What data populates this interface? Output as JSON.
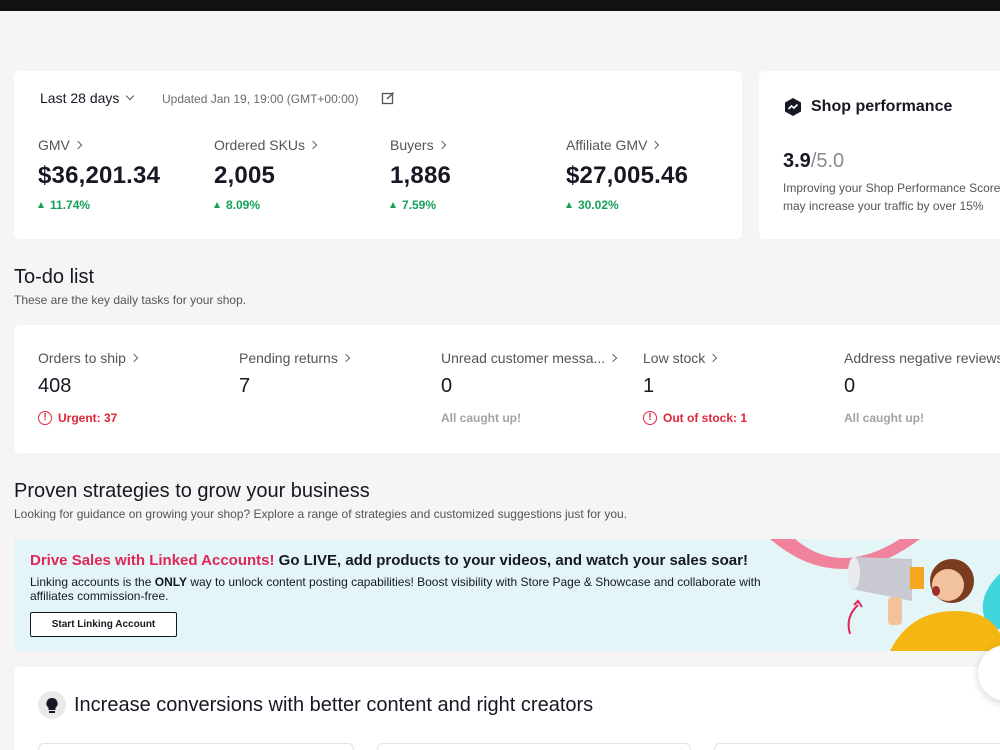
{
  "metrics": {
    "range": "Last 28 days",
    "updated": "Updated Jan 19, 19:00 (GMT+00:00)",
    "items": [
      {
        "label": "GMV",
        "value": "$36,201.34",
        "delta": "11.74%"
      },
      {
        "label": "Ordered SKUs",
        "value": "2,005",
        "delta": "8.09%"
      },
      {
        "label": "Buyers",
        "value": "1,886",
        "delta": "7.59%"
      },
      {
        "label": "Affiliate GMV",
        "value": "$27,005.46",
        "delta": "30.02%"
      }
    ]
  },
  "performance": {
    "title": "Shop performance",
    "score": "3.9",
    "max": "/5.0",
    "description": "Improving your Shop Performance Score may increase your traffic by over 15%"
  },
  "todo": {
    "title": "To-do list",
    "subtitle": "These are the key daily tasks for your shop.",
    "items": [
      {
        "label": "Orders to ship",
        "value": "408",
        "note": "Urgent: 37"
      },
      {
        "label": "Pending returns",
        "value": "7",
        "note": ""
      },
      {
        "label": "Unread customer messa...",
        "value": "0",
        "note": "All caught up!"
      },
      {
        "label": "Low stock",
        "value": "1",
        "note": "Out of stock: 1"
      },
      {
        "label": "Address negative reviews",
        "value": "0",
        "note": "All caught up!"
      }
    ]
  },
  "strategies": {
    "title": "Proven strategies to grow your business",
    "subtitle": "Looking for guidance on growing your shop? Explore a range of strategies and customized suggestions just for you.",
    "banner": {
      "highlight": "Drive Sales with Linked Accounts!",
      "headline": " Go LIVE, add products to your videos, and watch your sales soar!",
      "body_pre": "Linking accounts is the ",
      "body_bold": "ONLY",
      "body_post": " way to unlock content posting capabilities! Boost visibility with Store Page & Showcase and collaborate with affiliates commission-free.",
      "button": "Start Linking Account"
    }
  },
  "conversions": {
    "title": "Increase conversions with better content and right creators"
  },
  "colors": {
    "accent_pink": "#e0265a",
    "positive": "#14a058",
    "alert": "#e0263a",
    "banner_bg": "#e3f5f6"
  }
}
